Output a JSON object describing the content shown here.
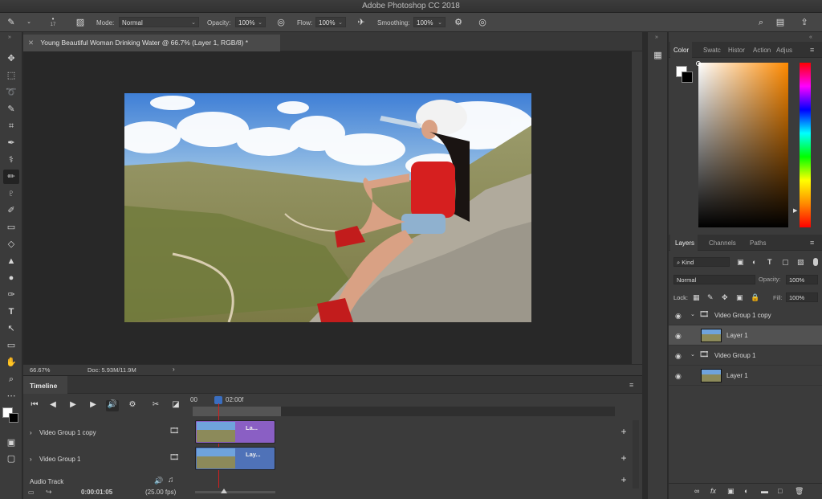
{
  "app": {
    "title": "Adobe Photoshop CC 2018"
  },
  "options_bar": {
    "brush_size": "17",
    "mode_label": "Mode:",
    "mode_value": "Normal",
    "opacity_label": "Opacity:",
    "opacity_value": "100%",
    "flow_label": "Flow:",
    "flow_value": "100%",
    "smoothing_label": "Smoothing:",
    "smoothing_value": "100%"
  },
  "document": {
    "tab_title": "Young Beautiful Woman Drinking Water @ 66.7% (Layer 1, RGB/8) *",
    "zoom": "66.67%",
    "doc_size": "Doc: 5.93M/11.9M"
  },
  "timeline": {
    "tab_label": "Timeline",
    "ruler_start": "00",
    "ruler_marker": "02:00f",
    "tracks": [
      {
        "name": "Video Group 1 copy",
        "clip_label": "La...",
        "clip_color": "#8a5fc4"
      },
      {
        "name": "Video Group 1",
        "clip_label": "Lay...",
        "clip_color": "#4f72b8"
      }
    ],
    "audio_track_label": "Audio Track",
    "current_time": "0:00:01:05",
    "fps": "(25.00 fps)"
  },
  "color_panel": {
    "tabs": [
      "Color",
      "Swatc",
      "Histor",
      "Action",
      "Adjus"
    ],
    "active_tab": "Color",
    "hue_color": "#ff8a00"
  },
  "layers_panel": {
    "tabs": [
      "Layers",
      "Channels",
      "Paths"
    ],
    "active_tab": "Layers",
    "filter_kind": "Kind",
    "blend_mode": "Normal",
    "opacity_label": "Opacity:",
    "opacity_value": "100%",
    "lock_label": "Lock:",
    "fill_label": "Fill:",
    "fill_value": "100%",
    "layers": [
      {
        "name": "Video Group 1 copy",
        "type": "group"
      },
      {
        "name": "Layer 1",
        "type": "layer",
        "selected": true
      },
      {
        "name": "Video Group 1",
        "type": "group"
      },
      {
        "name": "Layer 1",
        "type": "layer",
        "selected": false
      }
    ]
  }
}
